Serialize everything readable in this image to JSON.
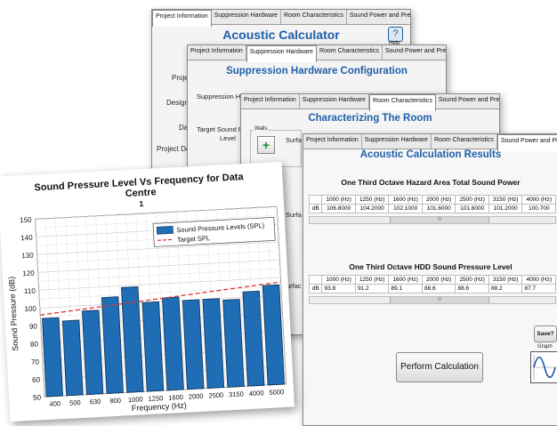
{
  "tabs": [
    "Project Information",
    "Suppression Hardware",
    "Room Characteristics",
    "Sound Power and Pressure"
  ],
  "w1": {
    "title": "Acoustic Calculator",
    "help_label": "Help",
    "help_glyph": "?",
    "fields": [
      "Project",
      "Designer",
      "Da",
      "Project De"
    ]
  },
  "w2": {
    "title": "Suppression Hardware Configuration",
    "fields": [
      "Suppression Hard",
      "Target Sound Pr",
      "Level"
    ]
  },
  "w3": {
    "title": "Characterizing The Room",
    "walls_label": "Walls",
    "add_glyph": "+",
    "fields": [
      "Surfa",
      "Surfa",
      "Surfac"
    ]
  },
  "w4": {
    "title": "Acoustic Calculation Results",
    "table1": {
      "title": "One Third Octave Hazard Area Total Sound Power",
      "headers": [
        "1000 (Hz)",
        "1250 (Hz)",
        "1600 (Hz)",
        "2000 (Hz)",
        "2500 (Hz)",
        "3150 (Hz)",
        "4000 (Hz)"
      ],
      "row_label": "dB",
      "values": [
        "106.8000",
        "104.2000",
        "102.1000",
        "101.6000",
        "101.6000",
        "101.2000",
        "100.700"
      ]
    },
    "table2": {
      "title": "One Third Octave HDD Sound Pressure Level",
      "headers": [
        "1000 (Hz)",
        "1250 (Hz)",
        "1600 (Hz)",
        "2000 (Hz)",
        "2500 (Hz)",
        "3150 (Hz)",
        "4000 (Hz)"
      ],
      "row_label": "dB",
      "values": [
        "93.8",
        "91.2",
        "89.1",
        "88.6",
        "88.6",
        "88.2",
        "87.7"
      ]
    },
    "perform_label": "Perform Calculation",
    "save_label": "Save?",
    "graph_label": "Graph",
    "scroll_marker": "III"
  },
  "chart_data": {
    "type": "bar",
    "title": "Sound Pressure Level Vs Frequency for Data Centre",
    "subtitle": "1",
    "xlabel": "Frequency (Hz)",
    "ylabel": "Sound Pressure (dB)",
    "categories": [
      "400",
      "500",
      "630",
      "800",
      "1000",
      "1250",
      "1600",
      "2000",
      "2500",
      "3150",
      "4000",
      "5000"
    ],
    "series": [
      {
        "name": "Sound Pressure Levels (SPL)",
        "values": [
          94,
          92,
          97,
          104,
          109,
          100,
          102,
          100,
          100,
          99,
          103,
          106
        ],
        "color": "#1f6db5"
      }
    ],
    "target": {
      "name": "Target SPL",
      "values": [
        96,
        107.5
      ],
      "color": "#e03030"
    },
    "ylim": [
      50,
      150
    ],
    "yticks": [
      50,
      60,
      70,
      80,
      90,
      100,
      110,
      120,
      130,
      140,
      150
    ],
    "grid": true,
    "legend_position": "top-right"
  }
}
